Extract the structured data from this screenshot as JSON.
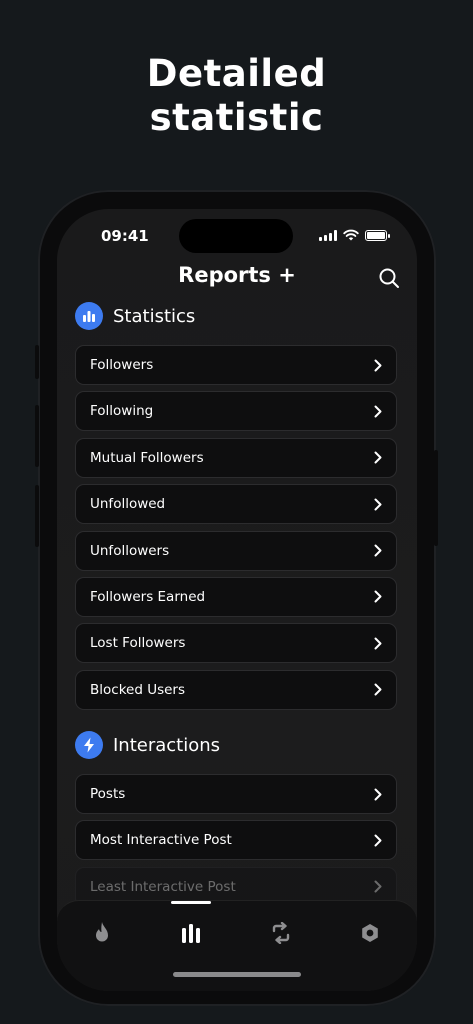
{
  "headline": {
    "line1": "Detailed",
    "line2": "statistic"
  },
  "status_bar": {
    "time": "09:41"
  },
  "nav": {
    "title": "Reports +"
  },
  "statistics": {
    "title": "Statistics",
    "items": [
      {
        "label": "Followers"
      },
      {
        "label": "Following"
      },
      {
        "label": "Mutual Followers"
      },
      {
        "label": "Unfollowed"
      },
      {
        "label": "Unfollowers"
      },
      {
        "label": "Followers Earned"
      },
      {
        "label": "Lost Followers"
      },
      {
        "label": "Blocked Users"
      }
    ]
  },
  "interactions": {
    "title": "Interactions",
    "items": [
      {
        "label": "Posts"
      },
      {
        "label": "Most Interactive Post"
      },
      {
        "label": "Least Interactive Post"
      }
    ]
  },
  "tabbar": {
    "tabs": [
      {
        "icon": "flame-icon"
      },
      {
        "icon": "bar-chart-icon",
        "selected": true
      },
      {
        "icon": "repost-icon"
      },
      {
        "icon": "settings-icon"
      }
    ]
  },
  "colors": {
    "accent": "#3d7bf0",
    "background": "#15191c",
    "row": "#0e0e0f"
  }
}
